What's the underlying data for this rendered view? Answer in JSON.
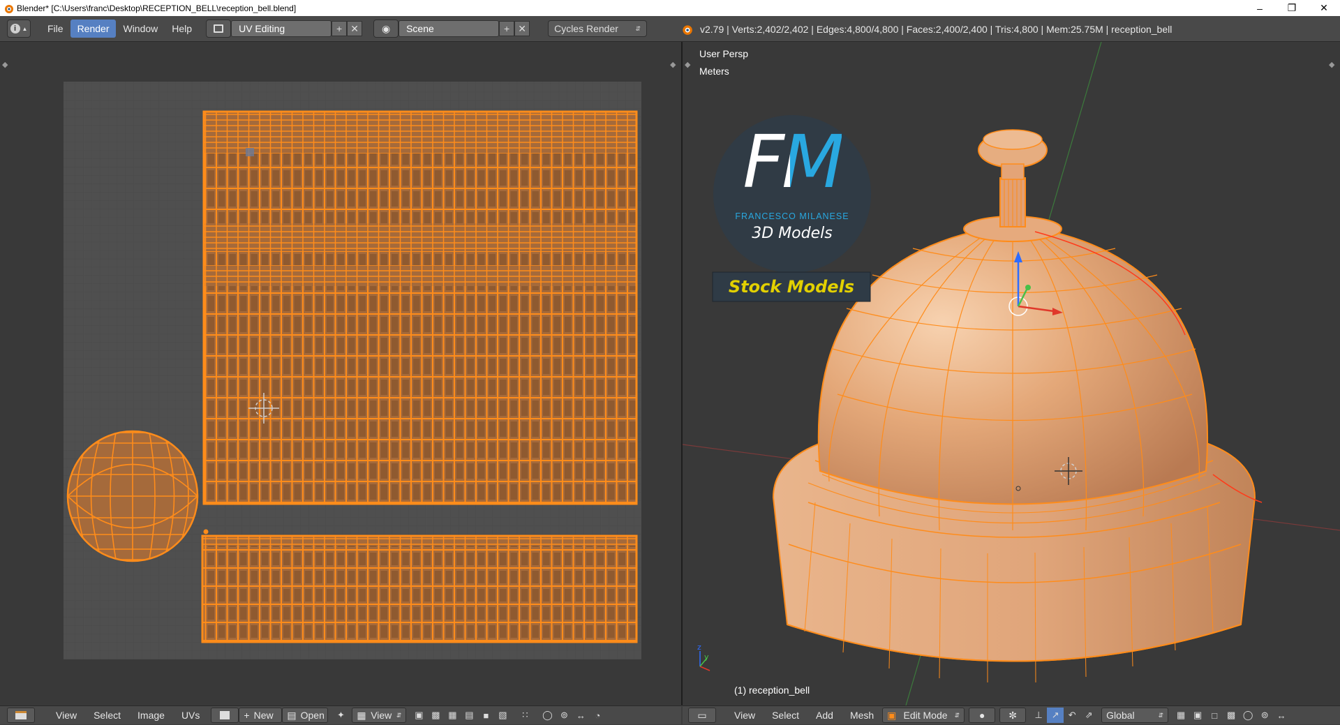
{
  "window": {
    "title": "Blender* [C:\\Users\\franc\\Desktop\\RECEPTION_BELL\\reception_bell.blend]",
    "controls": [
      "minimize",
      "restore",
      "close"
    ]
  },
  "info_header": {
    "menus": [
      "File",
      "Render",
      "Window",
      "Help"
    ],
    "active_menu": "Render",
    "screen_layout": "UV Editing",
    "scene": "Scene",
    "render_engine": "Cycles Render",
    "stats": "v2.79 | Verts:2,402/2,402 | Edges:4,800/4,800 | Faces:2,400/2,400 | Tris:4,800 | Mem:25.75M | reception_bell"
  },
  "uv_editor": {
    "menus": [
      "View",
      "Select",
      "Image",
      "UVs"
    ],
    "new_label": "New",
    "open_label": "Open",
    "view_label": "View"
  },
  "viewport": {
    "view_name": "User Persp",
    "units": "Meters",
    "object_label": "(1) reception_bell",
    "menus": [
      "View",
      "Select",
      "Add",
      "Mesh"
    ],
    "mode": "Edit Mode",
    "orientation": "Global"
  },
  "watermark": {
    "initials": "FM",
    "author": "FRANCESCO MILANESE",
    "tagline": "3D Models",
    "banner": "Stock Models"
  },
  "colors": {
    "accent_blue": "#5680c2",
    "uv_orange": "#ff8c1a",
    "bell_copper": "#e8a878",
    "fm_blue": "#29a8e0",
    "banner_yellow": "#e2d000"
  },
  "icons": [
    "info-icon",
    "layout-icon",
    "scene-icon",
    "blender-logo-icon",
    "image-editor-icon",
    "mesh-cube-icon",
    "axis-gizmo-icon"
  ]
}
